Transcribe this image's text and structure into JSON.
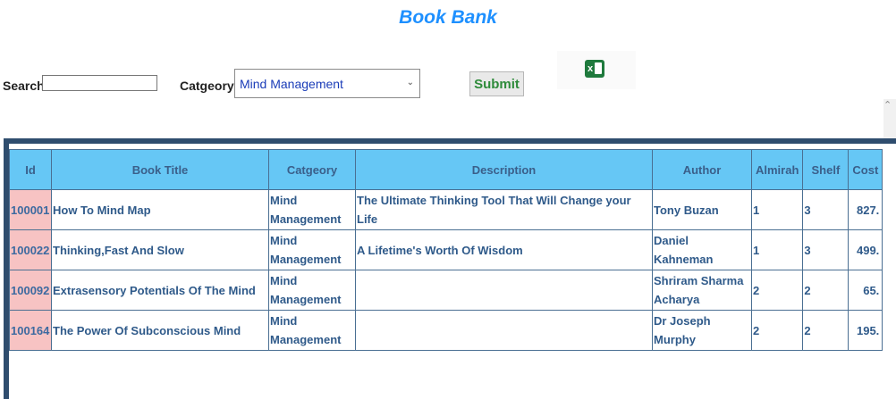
{
  "title": "Book Bank",
  "search": {
    "label": "Search",
    "value": ""
  },
  "category": {
    "label": "Catgeory",
    "selected": "Mind Management"
  },
  "submit_label": "Submit",
  "excel_icon": "excel-icon",
  "table": {
    "headers": [
      "Id",
      "Book Title",
      "Catgeory",
      "Description",
      "Author",
      "Almirah",
      "Shelf",
      "Cost"
    ],
    "rows": [
      [
        "100001",
        "How To Mind Map",
        "Mind Management",
        "The Ultimate Thinking Tool That Will Change your Life",
        "Tony Buzan",
        "1",
        "3",
        "827."
      ],
      [
        "100022",
        "Thinking,Fast And Slow",
        "Mind Management",
        "A Lifetime's Worth Of Wisdom",
        "Daniel Kahneman",
        "1",
        "3",
        "499."
      ],
      [
        "100092",
        "Extrasensory Potentials Of The Mind",
        "Mind Management",
        "",
        "Shriram Sharma Acharya",
        "2",
        "2",
        "65."
      ],
      [
        "100164",
        "The Power Of Subconscious Mind",
        "Mind Management",
        "",
        "Dr Joseph Murphy",
        "2",
        "2",
        "195."
      ]
    ]
  },
  "colors": {
    "title": "#1e90ff",
    "header_bg": "#66c7f5",
    "id_bg": "#f7c3c3",
    "panel": "#2f4d6e"
  }
}
